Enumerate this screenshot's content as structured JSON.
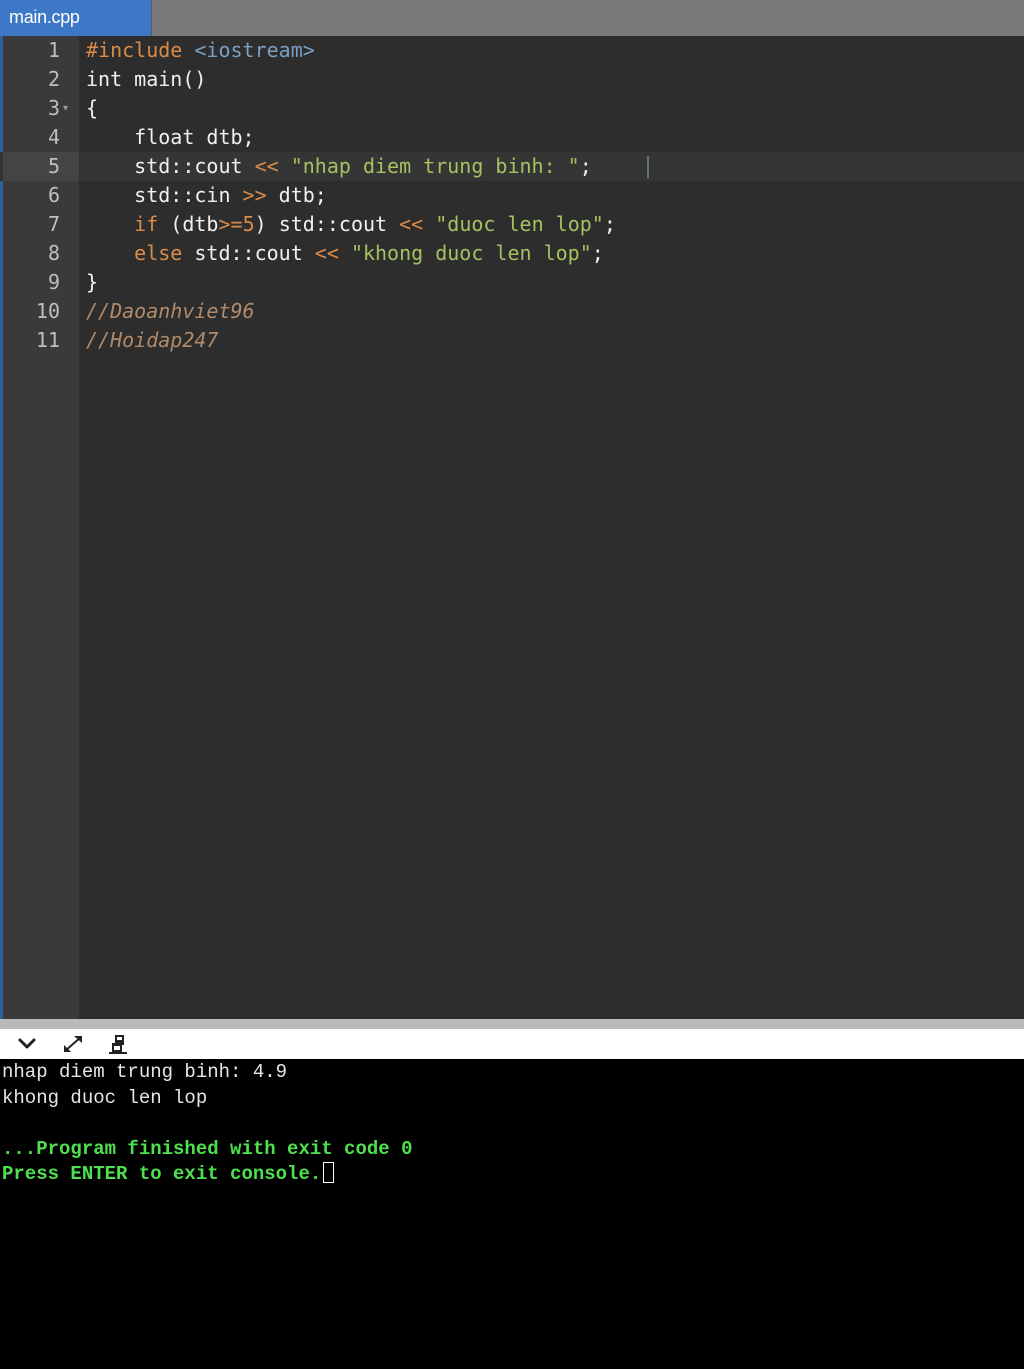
{
  "tab": {
    "label": "main.cpp"
  },
  "editor": {
    "lines": [
      {
        "num": "1",
        "tokens": [
          {
            "t": "#include",
            "k": "dir"
          },
          {
            "t": " ",
            "k": "txt"
          },
          {
            "t": "<iostream>",
            "k": "hdr"
          }
        ]
      },
      {
        "num": "2",
        "tokens": [
          {
            "t": "int main()",
            "k": "txt"
          }
        ]
      },
      {
        "num": "3",
        "fold": "▾",
        "tokens": [
          {
            "t": "{",
            "k": "txt"
          }
        ]
      },
      {
        "num": "4",
        "tokens": [
          {
            "t": "    float dtb;",
            "k": "txt"
          }
        ]
      },
      {
        "num": "5",
        "tokens": [
          {
            "t": "    std::cout ",
            "k": "txt"
          },
          {
            "t": "<<",
            "k": "op"
          },
          {
            "t": " ",
            "k": "txt"
          },
          {
            "t": "\"nhap diem trung binh: \"",
            "k": "str"
          },
          {
            "t": ";",
            "k": "txt"
          }
        ]
      },
      {
        "num": "6",
        "tokens": [
          {
            "t": "    std::cin ",
            "k": "txt"
          },
          {
            "t": ">>",
            "k": "op"
          },
          {
            "t": " dtb;",
            "k": "txt"
          }
        ]
      },
      {
        "num": "7",
        "tokens": [
          {
            "t": "    ",
            "k": "txt"
          },
          {
            "t": "if",
            "k": "kw"
          },
          {
            "t": " (dtb",
            "k": "txt"
          },
          {
            "t": ">=",
            "k": "op"
          },
          {
            "t": "5",
            "k": "num"
          },
          {
            "t": ") std::cout ",
            "k": "txt"
          },
          {
            "t": "<<",
            "k": "op"
          },
          {
            "t": " ",
            "k": "txt"
          },
          {
            "t": "\"duoc len lop\"",
            "k": "str"
          },
          {
            "t": ";",
            "k": "txt"
          }
        ]
      },
      {
        "num": "8",
        "tokens": [
          {
            "t": "    ",
            "k": "txt"
          },
          {
            "t": "else",
            "k": "kw"
          },
          {
            "t": " std::cout ",
            "k": "txt"
          },
          {
            "t": "<<",
            "k": "op"
          },
          {
            "t": " ",
            "k": "txt"
          },
          {
            "t": "\"khong duoc len lop\"",
            "k": "str"
          },
          {
            "t": ";",
            "k": "txt"
          }
        ]
      },
      {
        "num": "9",
        "tokens": [
          {
            "t": "}",
            "k": "txt"
          }
        ]
      },
      {
        "num": "10",
        "tokens": [
          {
            "t": "//Daoanhviet96",
            "k": "cmt"
          }
        ]
      },
      {
        "num": "11",
        "tokens": [
          {
            "t": "//Hoidap247",
            "k": "cmt"
          }
        ]
      }
    ],
    "active_line": "5"
  },
  "console_toolbar": {
    "buttons": [
      {
        "name": "collapse-console-button",
        "icon": "chevron-down-icon"
      },
      {
        "name": "expand-console-button",
        "icon": "expand-arrows-icon"
      },
      {
        "name": "clear-console-button",
        "icon": "eraser-icon"
      }
    ]
  },
  "console": {
    "lines": [
      {
        "text": "nhap diem trung binh: 4.9",
        "style": "white"
      },
      {
        "text": "khong duoc len lop",
        "style": "white"
      },
      {
        "text": "",
        "style": "white"
      },
      {
        "text": "...Program finished with exit code 0",
        "style": "green"
      },
      {
        "text": "Press ENTER to exit console.",
        "style": "green",
        "cursor": true
      }
    ]
  },
  "colors": {
    "tab_active": "#3d78c6",
    "editor_bg": "#2d2d2d",
    "gutter_bg": "#3a3a3a",
    "keyword": "#d98c4a",
    "string": "#a5c261",
    "comment": "#b08a6a",
    "header": "#7a9fc2",
    "console_bg": "#000000",
    "console_green": "#4ee04e"
  }
}
